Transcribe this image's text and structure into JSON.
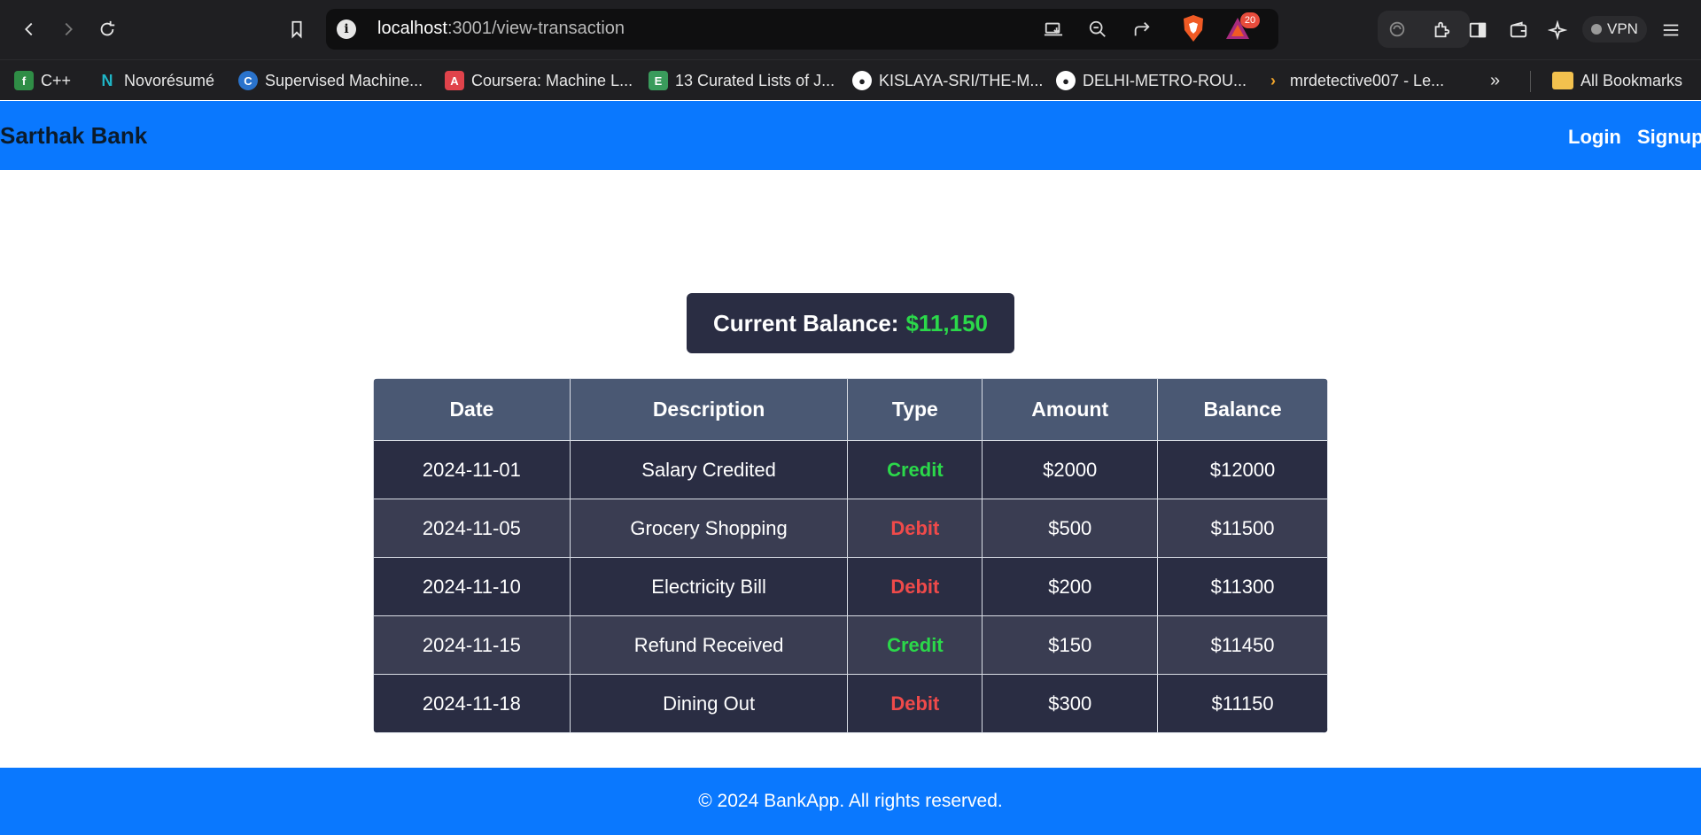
{
  "browser": {
    "url_host": "localhost",
    "url_path": ":3001/view-transaction",
    "rewards_badge": "20",
    "vpn_label": "VPN",
    "bookmarks": [
      {
        "label": "C++",
        "icon": "gfg-icon",
        "color": "#2f8d46"
      },
      {
        "label": "Novorésumé",
        "icon": "novoresume-icon",
        "color": "#1fb5c6"
      },
      {
        "label": "Supervised Machine...",
        "icon": "coursera-c-icon",
        "color": "#2a73cc"
      },
      {
        "label": "Coursera: Machine L...",
        "icon": "bookmark-red-icon",
        "color": "#e0434b"
      },
      {
        "label": "13 Curated Lists of J...",
        "icon": "evernote-e-icon",
        "color": "#3a9b5c"
      },
      {
        "label": "KISLAYA-SRI/THE-M...",
        "icon": "github-icon",
        "color": "#ffffff"
      },
      {
        "label": "DELHI-METRO-ROU...",
        "icon": "github-icon",
        "color": "#ffffff"
      },
      {
        "label": "mrdetective007 - Le...",
        "icon": "leetcode-icon",
        "color": "#f0a42b"
      }
    ],
    "all_bookmarks_label": "All Bookmarks"
  },
  "app": {
    "brand": "Sarthak Bank",
    "nav": {
      "login": "Login",
      "signup": "Signup"
    },
    "balance_label": "Current Balance:",
    "balance_value": "$11,150",
    "table": {
      "headers": [
        "Date",
        "Description",
        "Type",
        "Amount",
        "Balance"
      ],
      "rows": [
        {
          "date": "2024-11-01",
          "description": "Salary Credited",
          "type": "Credit",
          "amount": "$2000",
          "balance": "$12000"
        },
        {
          "date": "2024-11-05",
          "description": "Grocery Shopping",
          "type": "Debit",
          "amount": "$500",
          "balance": "$11500"
        },
        {
          "date": "2024-11-10",
          "description": "Electricity Bill",
          "type": "Debit",
          "amount": "$200",
          "balance": "$11300"
        },
        {
          "date": "2024-11-15",
          "description": "Refund Received",
          "type": "Credit",
          "amount": "$150",
          "balance": "$11450"
        },
        {
          "date": "2024-11-18",
          "description": "Dining Out",
          "type": "Debit",
          "amount": "$300",
          "balance": "$11150"
        }
      ]
    },
    "footer": "© 2024 BankApp. All rights reserved.",
    "colors": {
      "primary": "#0a78fe",
      "dark": "#2a2d43",
      "credit": "#2bd84a",
      "debit": "#ef4a4a"
    }
  }
}
